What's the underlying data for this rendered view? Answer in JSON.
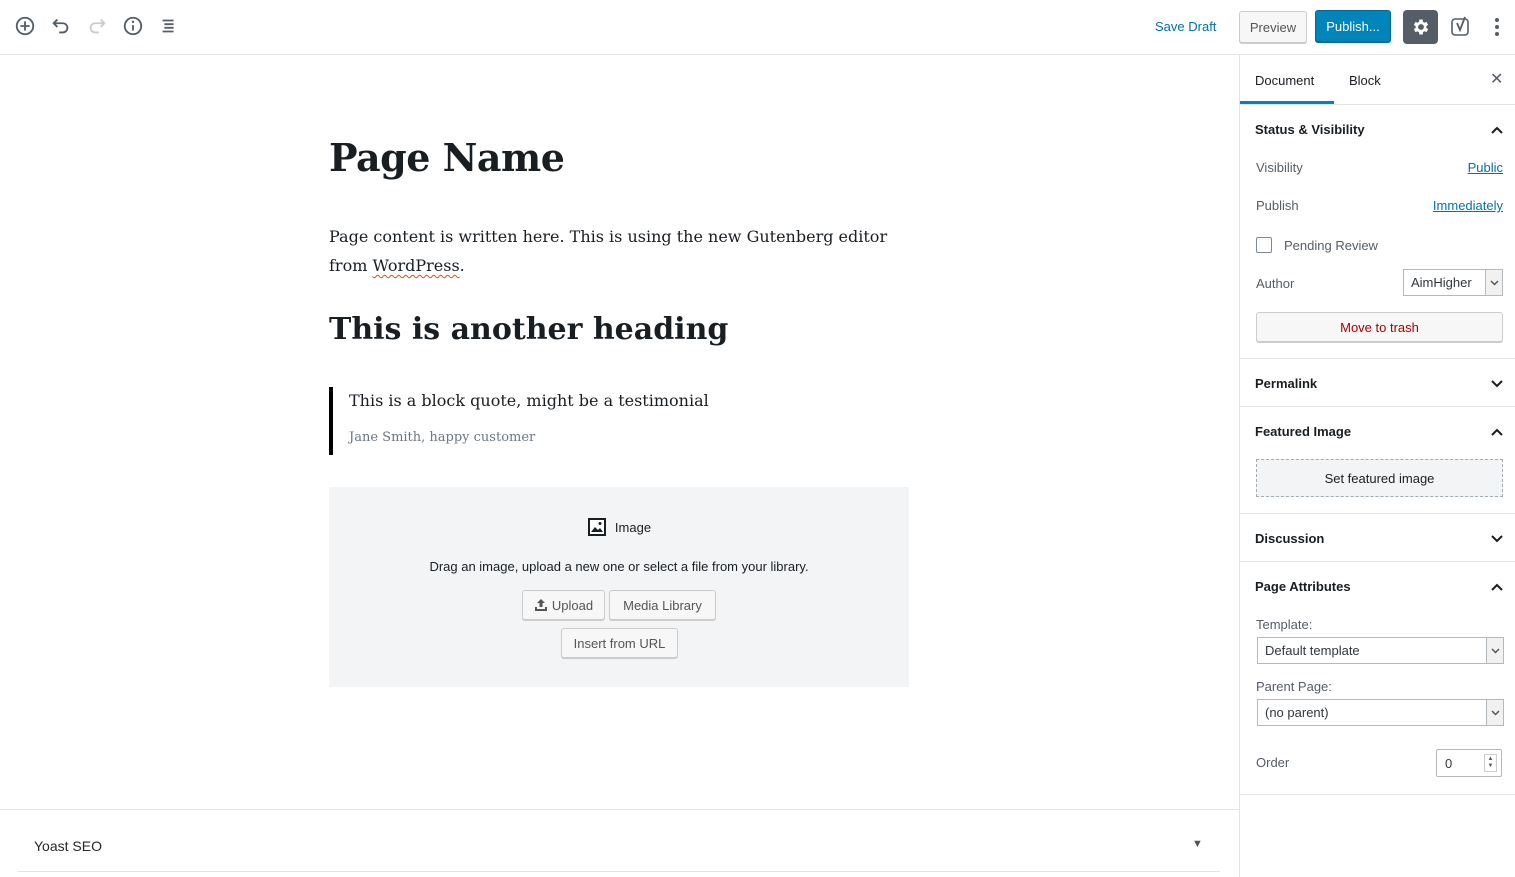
{
  "toolbar": {
    "add_block_icon": "plus-circle-icon",
    "undo_icon": "undo-icon",
    "redo_icon": "redo-icon",
    "info_icon": "info-icon",
    "outline_icon": "list-icon",
    "save_draft": "Save Draft",
    "preview": "Preview",
    "publish": "Publish...",
    "settings_icon": "gear-icon",
    "yoast_icon": "yoast-icon",
    "more_icon": "vertical-ellipsis-icon"
  },
  "editor": {
    "title": "Page Name",
    "paragraph_before": "Page content is written here. This is using the new Gutenberg editor from ",
    "paragraph_link": "WordPress",
    "paragraph_after": ".",
    "heading": "This is another heading",
    "quote_text": "This is a block quote, might be a testimonial",
    "quote_cite": "Jane Smith, happy customer",
    "image_block": {
      "label": "Image",
      "instructions": "Drag an image, upload a new one or select a file from your library.",
      "upload": "Upload",
      "media_library": "Media Library",
      "insert_url": "Insert from URL"
    }
  },
  "metabox": {
    "yoast_title": "Yoast SEO",
    "arrow": "▼"
  },
  "sidebar": {
    "tabs": [
      "Document",
      "Block"
    ],
    "close": "✕",
    "status_visibility": {
      "title": "Status & Visibility",
      "visibility_label": "Visibility",
      "visibility_value": "Public",
      "publish_label": "Publish",
      "publish_value": "Immediately",
      "pending_label": "Pending Review",
      "author_label": "Author",
      "author_value": "AimHigher",
      "trash": "Move to trash"
    },
    "permalink": "Permalink",
    "featured_image": {
      "title": "Featured Image",
      "button": "Set featured image"
    },
    "discussion": "Discussion",
    "page_attributes": {
      "title": "Page Attributes",
      "template_label": "Template:",
      "template_value": "Default template",
      "parent_label": "Parent Page:",
      "parent_value": "(no parent)",
      "order_label": "Order",
      "order_value": "0"
    }
  },
  "colors": {
    "accent": "#0085ba",
    "link": "#0073aa",
    "danger": "#aa0000"
  }
}
